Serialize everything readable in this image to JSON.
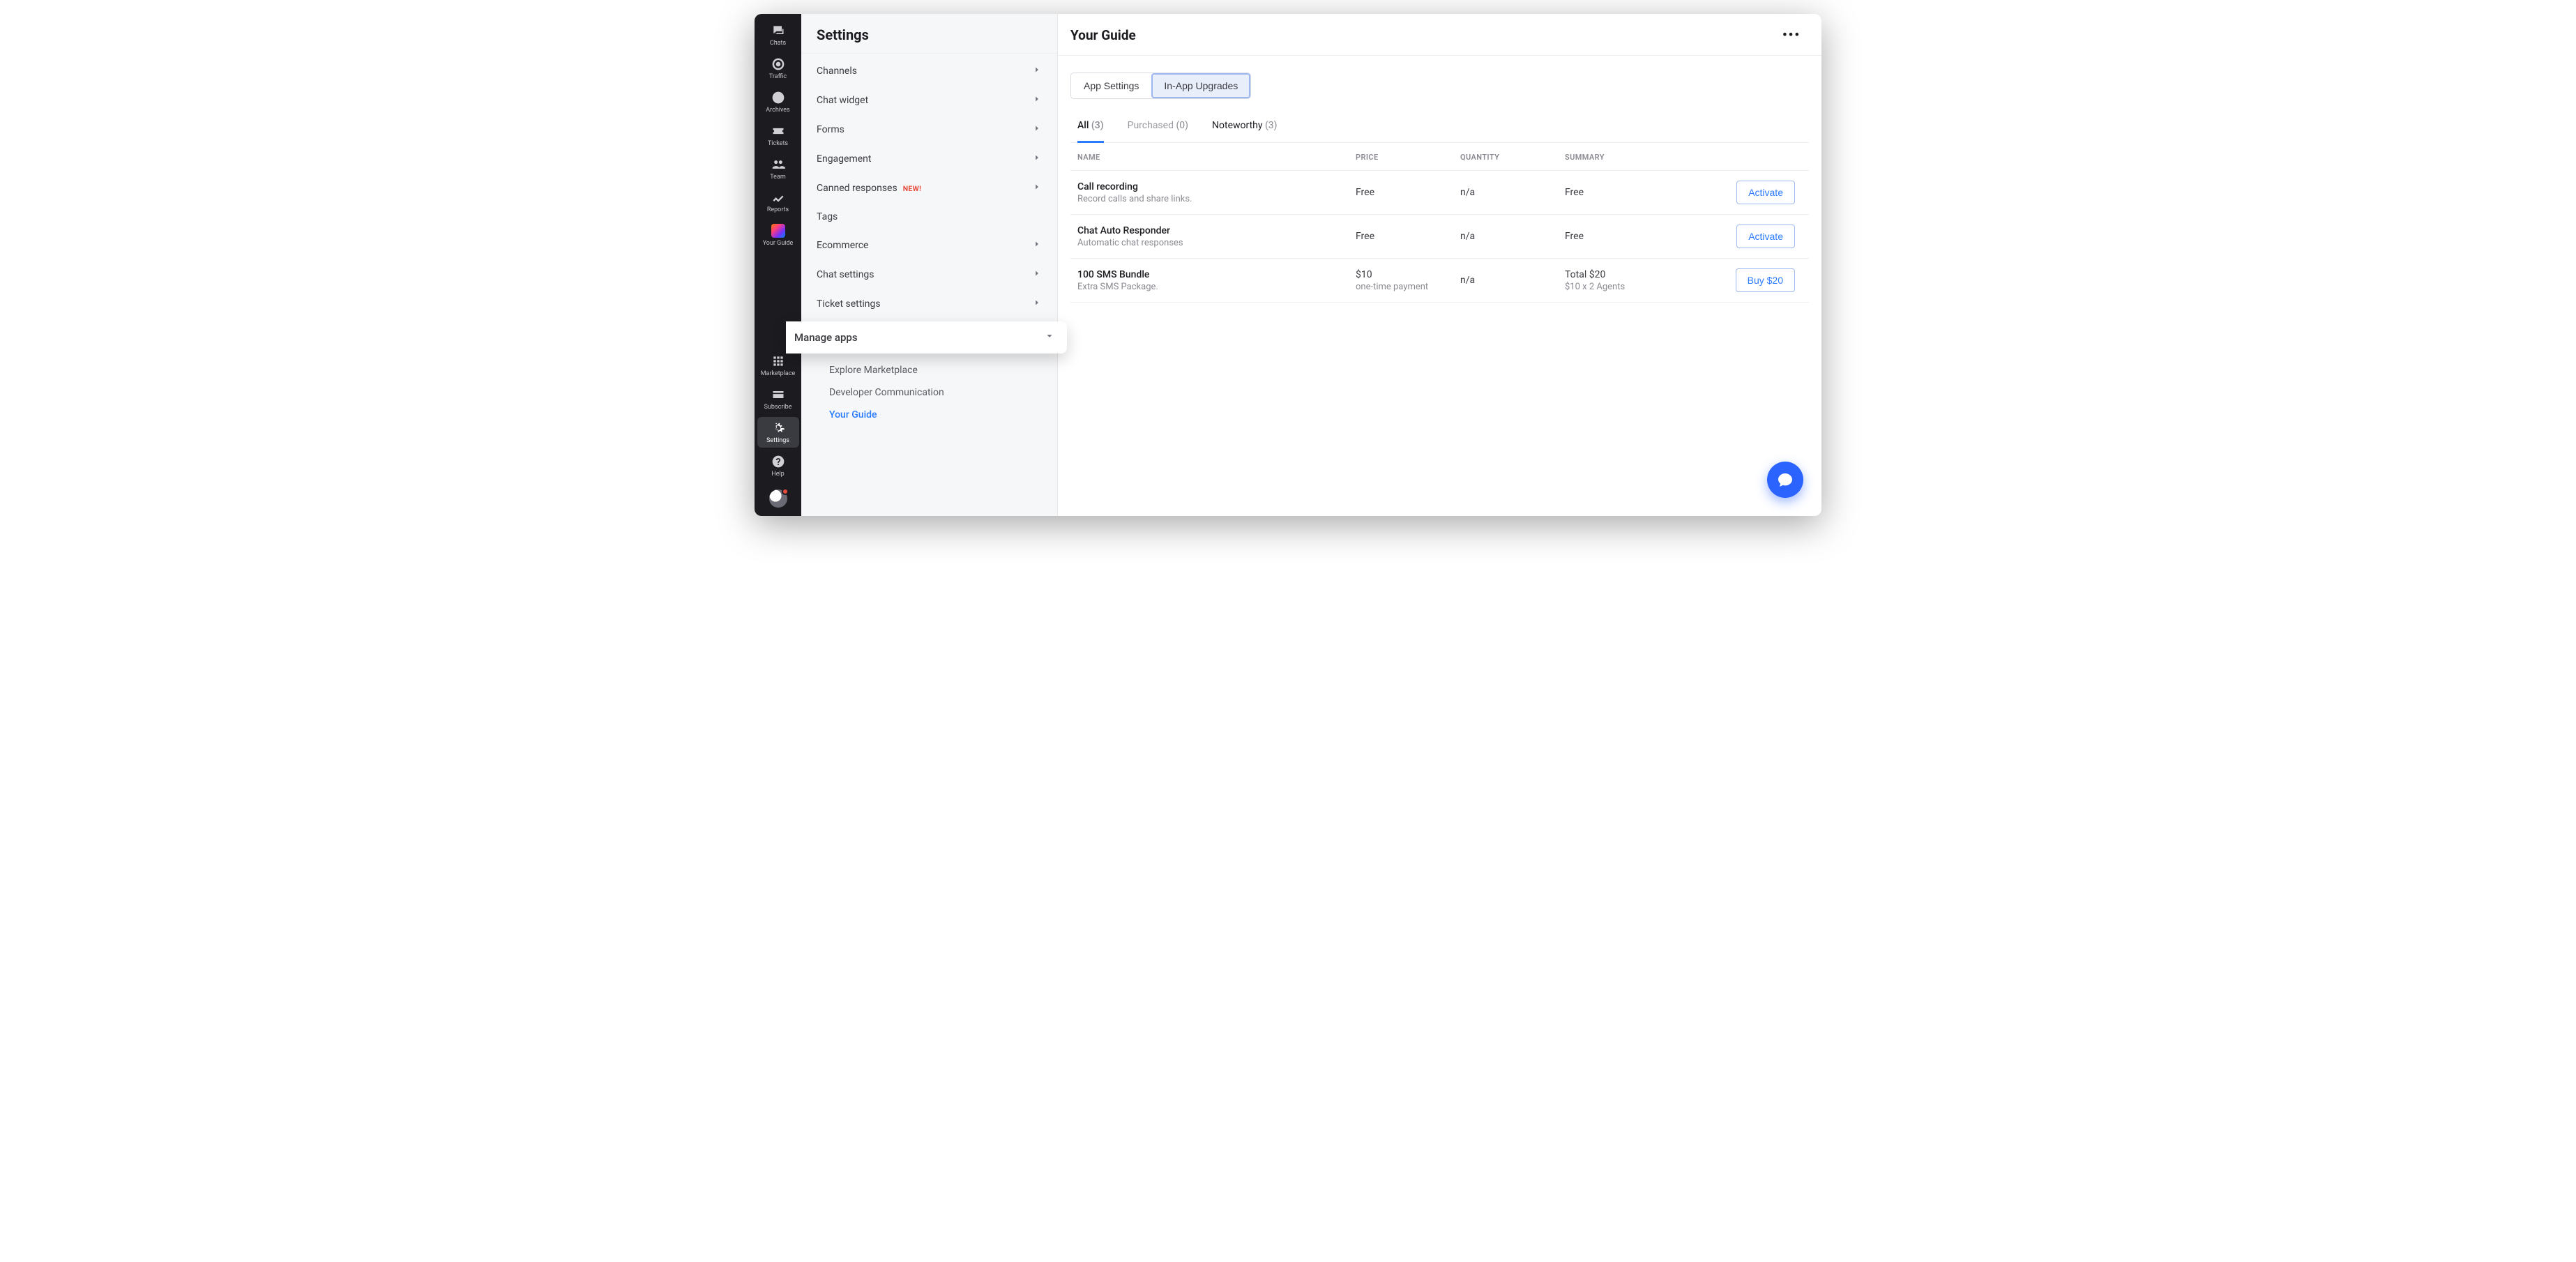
{
  "rail": {
    "items": [
      {
        "key": "chats",
        "label": "Chats"
      },
      {
        "key": "traffic",
        "label": "Traffic"
      },
      {
        "key": "archives",
        "label": "Archives"
      },
      {
        "key": "tickets",
        "label": "Tickets"
      },
      {
        "key": "team",
        "label": "Team"
      },
      {
        "key": "reports",
        "label": "Reports"
      },
      {
        "key": "your-guide",
        "label": "Your Guide"
      }
    ],
    "bottom": [
      {
        "key": "marketplace",
        "label": "Marketplace"
      },
      {
        "key": "subscribe",
        "label": "Subscribe"
      },
      {
        "key": "settings",
        "label": "Settings"
      },
      {
        "key": "help",
        "label": "Help"
      }
    ]
  },
  "settings": {
    "title": "Settings",
    "items": [
      {
        "key": "channels",
        "label": "Channels",
        "chevron": true
      },
      {
        "key": "chat-widget",
        "label": "Chat widget",
        "chevron": true
      },
      {
        "key": "forms",
        "label": "Forms",
        "chevron": true
      },
      {
        "key": "engagement",
        "label": "Engagement",
        "chevron": true
      },
      {
        "key": "canned",
        "label": "Canned responses",
        "chevron": true,
        "badge": "NEW!"
      },
      {
        "key": "tags",
        "label": "Tags",
        "chevron": false
      },
      {
        "key": "ecommerce",
        "label": "Ecommerce",
        "chevron": true
      },
      {
        "key": "chat-settings",
        "label": "Chat settings",
        "chevron": true
      },
      {
        "key": "ticket-settings",
        "label": "Ticket settings",
        "chevron": true
      }
    ],
    "manage_apps": {
      "label": "Manage apps",
      "children": [
        {
          "key": "explore",
          "label": "Explore Marketplace"
        },
        {
          "key": "devcom",
          "label": "Developer Communication"
        },
        {
          "key": "your-guide",
          "label": "Your Guide",
          "active": true
        }
      ]
    }
  },
  "page": {
    "title": "Your Guide",
    "segmented": [
      {
        "key": "app-settings",
        "label": "App Settings"
      },
      {
        "key": "in-app",
        "label": "In-App Upgrades",
        "active": true
      }
    ],
    "tabs": [
      {
        "key": "all",
        "label": "All",
        "count": "(3)",
        "active": true
      },
      {
        "key": "purchased",
        "label": "Purchased",
        "count": "(0)",
        "muted": true
      },
      {
        "key": "noteworthy",
        "label": "Noteworthy",
        "count": "(3)"
      }
    ],
    "columns": {
      "name": "NAME",
      "price": "PRICE",
      "quantity": "QUANTITY",
      "summary": "SUMMARY"
    },
    "rows": [
      {
        "name": "Call recording",
        "sub": "Record calls and share links.",
        "price": "Free",
        "quantity": "n/a",
        "summary": "Free",
        "summary_sub": "",
        "action": "Activate"
      },
      {
        "name": "Chat Auto Responder",
        "sub": "Automatic chat responses",
        "price": "Free",
        "quantity": "n/a",
        "summary": "Free",
        "summary_sub": "",
        "action": "Activate"
      },
      {
        "name": "100 SMS Bundle",
        "sub": "Extra SMS Package.",
        "price": "$10",
        "price_sub": "one-time payment",
        "quantity": "n/a",
        "summary": "Total $20",
        "summary_sub": "$10 x 2 Agents",
        "action": "Buy $20"
      }
    ]
  }
}
